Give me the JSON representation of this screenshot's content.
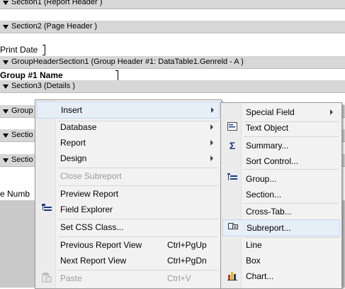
{
  "sections": {
    "section1": "Section1 (Report Header  )",
    "section2": "Section2 (Page Header  )",
    "group_header1": "GroupHeaderSection1 (Group Header #1: DataTable1.Genreld - A )",
    "section3": "Section3 (Details  )",
    "partial_group": "Group",
    "partial_section_a": "Sectio",
    "partial_section_b": "Sectio"
  },
  "fields": {
    "print_date": "Print Date",
    "group_name": "Group #1 Name",
    "page_number_partial": "e Numb"
  },
  "context_menu": {
    "insert": "Insert",
    "database": "Database",
    "report": "Report",
    "design": "Design",
    "close_subreport": "Close Subreport",
    "preview_report": "Preview Report",
    "field_explorer": "Field Explorer",
    "set_css_class": "Set CSS Class...",
    "previous_report_view": "Previous Report View",
    "previous_report_view_shortcut": "Ctrl+PgUp",
    "next_report_view": "Next Report View",
    "next_report_view_shortcut": "Ctrl+PgDn",
    "paste": "Paste",
    "paste_shortcut": "Ctrl+V"
  },
  "insert_submenu": {
    "special_field": "Special Field",
    "text_object": "Text Object",
    "summary": "Summary...",
    "sort_control": "Sort Control...",
    "group": "Group...",
    "section": "Section...",
    "cross_tab": "Cross-Tab...",
    "subreport": "Subreport...",
    "line": "Line",
    "box": "Box",
    "chart": "Chart..."
  }
}
